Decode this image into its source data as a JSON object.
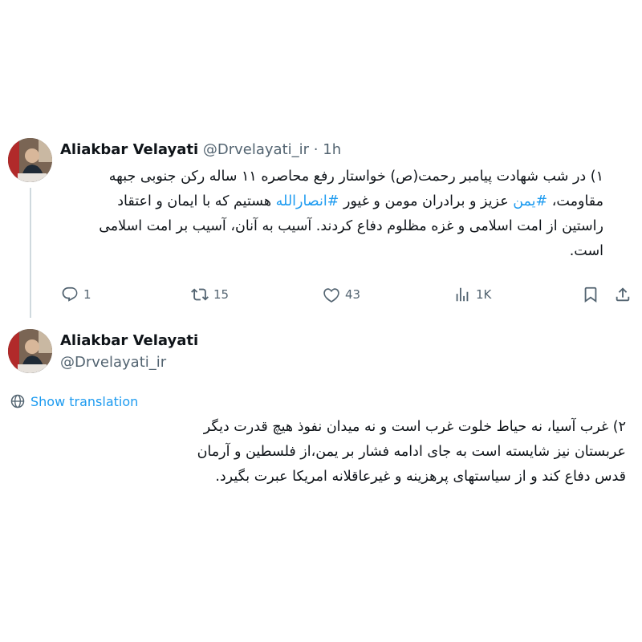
{
  "tweet1": {
    "author_name": "Aliakbar Velayati",
    "handle": "@Drvelayati_ir",
    "separator": "·",
    "time": "1h",
    "text": {
      "part1": "۱) در شب شهادت پیامبر رحمت(ص) خواستار رفع محاصره ۱۱ ساله رکن جنوبی جبهه مقاومت، ",
      "hashtag1": "#یمن",
      "part2": " عزیز و برادران مومن و غیور ",
      "hashtag2": "#انصارالله",
      "part3": " هستیم که با ایمان و اعتقاد راستین از امت اسلامی و غزه مظلوم دفاع کردند. آسیب به آنان، آسیب بر امت اسلامی است."
    },
    "stats": {
      "replies": "1",
      "reposts": "15",
      "likes": "43",
      "views": "1K"
    }
  },
  "tweet2": {
    "author_name": "Aliakbar Velayati",
    "handle": "@Drvelayati_ir",
    "show_translation": "Show translation",
    "text": "۲) غرب آسیا، نه حیاط خلوت غرب است و نه میدان نفوذ هیچ قدرت دیگر عربستان نیز شایسته است به جای ادامه فشار بر یمن،از فلسطین و آرمان قدس دفاع کند و از سیاستهای پرهزینه و غیرعاقلانه امریکا عبرت بگیرد."
  },
  "colors": {
    "accent": "#1d9bf0",
    "text": "#0f1419",
    "muted": "#536471",
    "thread_line": "#cfd9de"
  },
  "icons": [
    "reply-icon",
    "repost-icon",
    "like-icon",
    "views-icon",
    "bookmark-icon",
    "share-icon",
    "translate-globe-icon"
  ]
}
